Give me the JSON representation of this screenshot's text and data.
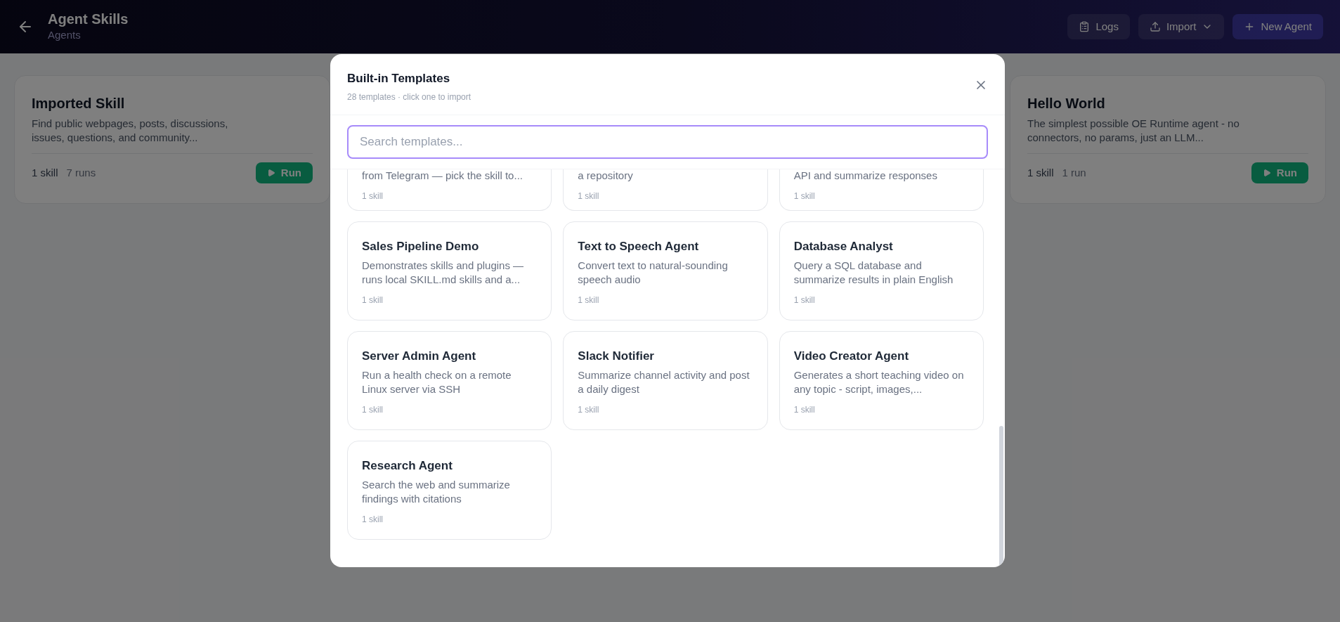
{
  "header": {
    "title": "Agent Skills",
    "subtitle": "Agents",
    "buttons": [
      {
        "kind": "logs",
        "label": "Logs"
      },
      {
        "kind": "import",
        "label": "Import"
      },
      {
        "kind": "new",
        "label": "New Agent"
      }
    ]
  },
  "agents": [
    {
      "name": "Imported Skill",
      "description": "Find public webpages, posts, discussions, issues, questions, and community...",
      "skills": "1 skill",
      "runs": "7 runs",
      "action": "Run"
    },
    {
      "name": "Hello World",
      "description": "The simplest possible OE Runtime agent - no connectors, no params, just an LLM...",
      "skills": "1 skill",
      "runs": "1 run",
      "action": "Run"
    }
  ],
  "modal": {
    "title": "Built-in Templates",
    "subtitle": "28 templates · click one to import",
    "search": {
      "placeholder": "Search templates..."
    },
    "partial_templates": [
      {
        "description_tail": "from Telegram — pick the skill to...",
        "skills": "1 skill"
      },
      {
        "description_tail": "a repository",
        "skills": "1 skill"
      },
      {
        "description_tail": "API and summarize responses",
        "skills": "1 skill"
      }
    ],
    "templates": [
      {
        "name": "Sales Pipeline Demo",
        "description": "Demonstrates skills and plugins — runs local SKILL.md skills and a...",
        "skills": "1 skill"
      },
      {
        "name": "Text to Speech Agent",
        "description": "Convert text to natural-sounding speech audio",
        "skills": "1 skill"
      },
      {
        "name": "Database Analyst",
        "description": "Query a SQL database and summarize results in plain English",
        "skills": "1 skill"
      },
      {
        "name": "Server Admin Agent",
        "description": "Run a health check on a remote Linux server via SSH",
        "skills": "1 skill"
      },
      {
        "name": "Slack Notifier",
        "description": "Summarize channel activity and post a daily digest",
        "skills": "1 skill"
      },
      {
        "name": "Video Creator Agent",
        "description": "Generates a short teaching video on any topic - script, images,...",
        "skills": "1 skill"
      },
      {
        "name": "Research Agent",
        "description": "Search the web and summarize findings with citations",
        "skills": "1 skill"
      }
    ]
  }
}
